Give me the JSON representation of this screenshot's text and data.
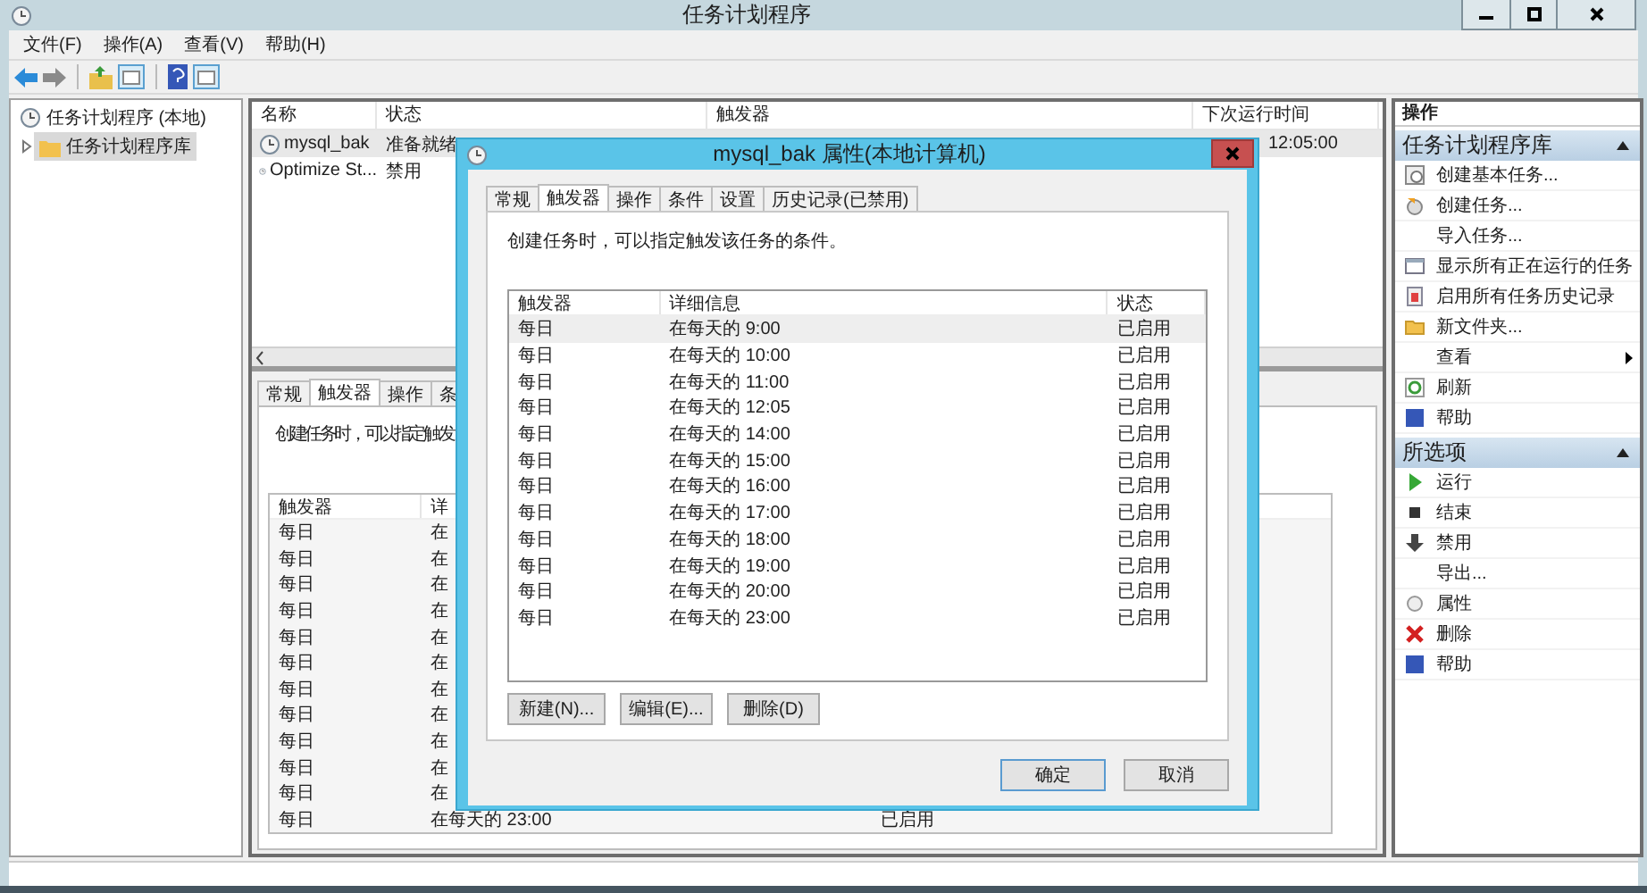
{
  "window": {
    "title": "任务计划程序"
  },
  "menu": [
    "文件(F)",
    "操作(A)",
    "查看(V)",
    "帮助(H)"
  ],
  "tree": [
    {
      "label": "任务计划程序 (本地)",
      "selected": false,
      "children": [
        {
          "label": "任务计划程序库",
          "selected": true,
          "expanded": false
        }
      ]
    }
  ],
  "task_table": {
    "columns": [
      "名称",
      "状态",
      "触发器",
      "下次运行时间"
    ],
    "rows": [
      {
        "name": "mysql_bak",
        "status": "准备就绪",
        "next_run": "12:05:00",
        "selected": true
      },
      {
        "name": "Optimize St...",
        "status": "禁用",
        "selected": false
      }
    ]
  },
  "detail_pane": {
    "tabs": [
      {
        "label": "常规",
        "selected": false
      },
      {
        "label": "触发器",
        "selected": true
      },
      {
        "label": "操作",
        "selected": false
      },
      {
        "label": "条",
        "selected": false
      }
    ],
    "description": "创建任务时，可以指定触发",
    "columns": [
      "触发器",
      "详"
    ],
    "rows": [
      {
        "trigger": "每日",
        "detail": "在"
      },
      {
        "trigger": "每日",
        "detail": "在"
      },
      {
        "trigger": "每日",
        "detail": "在"
      },
      {
        "trigger": "每日",
        "detail": "在"
      },
      {
        "trigger": "每日",
        "detail": "在"
      },
      {
        "trigger": "每日",
        "detail": "在"
      },
      {
        "trigger": "每日",
        "detail": "在"
      },
      {
        "trigger": "每日",
        "detail": "在"
      },
      {
        "trigger": "每日",
        "detail": "在"
      },
      {
        "trigger": "每日",
        "detail": "在"
      },
      {
        "trigger": "每日",
        "detail": "在"
      },
      {
        "trigger": "每日",
        "detail": "在每天的 23:00",
        "status": "已启用"
      }
    ]
  },
  "actions": {
    "title": "操作",
    "sections": [
      {
        "title": "任务计划程序库",
        "expanded": true,
        "items": [
          {
            "label": "创建基本任务...",
            "submenu": false
          },
          {
            "label": "创建任务...",
            "submenu": false
          },
          {
            "label": "导入任务...",
            "submenu": false
          },
          {
            "label": "显示所有正在运行的任务",
            "submenu": false
          },
          {
            "label": "启用所有任务历史记录",
            "submenu": false
          },
          {
            "label": "新文件夹...",
            "submenu": false
          },
          {
            "label": "查看",
            "submenu": true
          },
          {
            "label": "刷新",
            "submenu": false
          },
          {
            "label": "帮助",
            "submenu": false
          }
        ]
      },
      {
        "title": "所选项",
        "expanded": true,
        "items": [
          {
            "label": "运行",
            "submenu": false
          },
          {
            "label": "结束",
            "submenu": false
          },
          {
            "label": "禁用",
            "submenu": false
          },
          {
            "label": "导出...",
            "submenu": false
          },
          {
            "label": "属性",
            "submenu": false
          },
          {
            "label": "删除",
            "submenu": false
          },
          {
            "label": "帮助",
            "submenu": false
          }
        ]
      }
    ]
  },
  "dialog": {
    "title": "mysql_bak 属性(本地计算机)",
    "tabs": [
      {
        "label": "常规",
        "selected": false
      },
      {
        "label": "触发器",
        "selected": true
      },
      {
        "label": "操作",
        "selected": false
      },
      {
        "label": "条件",
        "selected": false
      },
      {
        "label": "设置",
        "selected": false
      },
      {
        "label": "历史记录(已禁用)",
        "selected": false
      }
    ],
    "description": "创建任务时，可以指定触发该任务的条件。",
    "columns": [
      "触发器",
      "详细信息",
      "状态"
    ],
    "rows": [
      {
        "trigger": "每日",
        "detail": "在每天的 9:00",
        "status": "已启用",
        "selected": true
      },
      {
        "trigger": "每日",
        "detail": "在每天的 10:00",
        "status": "已启用",
        "selected": false
      },
      {
        "trigger": "每日",
        "detail": "在每天的 11:00",
        "status": "已启用",
        "selected": false
      },
      {
        "trigger": "每日",
        "detail": "在每天的 12:05",
        "status": "已启用",
        "selected": false
      },
      {
        "trigger": "每日",
        "detail": "在每天的 14:00",
        "status": "已启用",
        "selected": false
      },
      {
        "trigger": "每日",
        "detail": "在每天的 15:00",
        "status": "已启用",
        "selected": false
      },
      {
        "trigger": "每日",
        "detail": "在每天的 16:00",
        "status": "已启用",
        "selected": false
      },
      {
        "trigger": "每日",
        "detail": "在每天的 17:00",
        "status": "已启用",
        "selected": false
      },
      {
        "trigger": "每日",
        "detail": "在每天的 18:00",
        "status": "已启用",
        "selected": false
      },
      {
        "trigger": "每日",
        "detail": "在每天的 19:00",
        "status": "已启用",
        "selected": false
      },
      {
        "trigger": "每日",
        "detail": "在每天的 20:00",
        "status": "已启用",
        "selected": false
      },
      {
        "trigger": "每日",
        "detail": "在每天的 23:00",
        "status": "已启用",
        "selected": false
      }
    ],
    "list_buttons": [
      "新建(N)...",
      "编辑(E)...",
      "删除(D)"
    ],
    "ok": "确定",
    "cancel": "取消"
  }
}
